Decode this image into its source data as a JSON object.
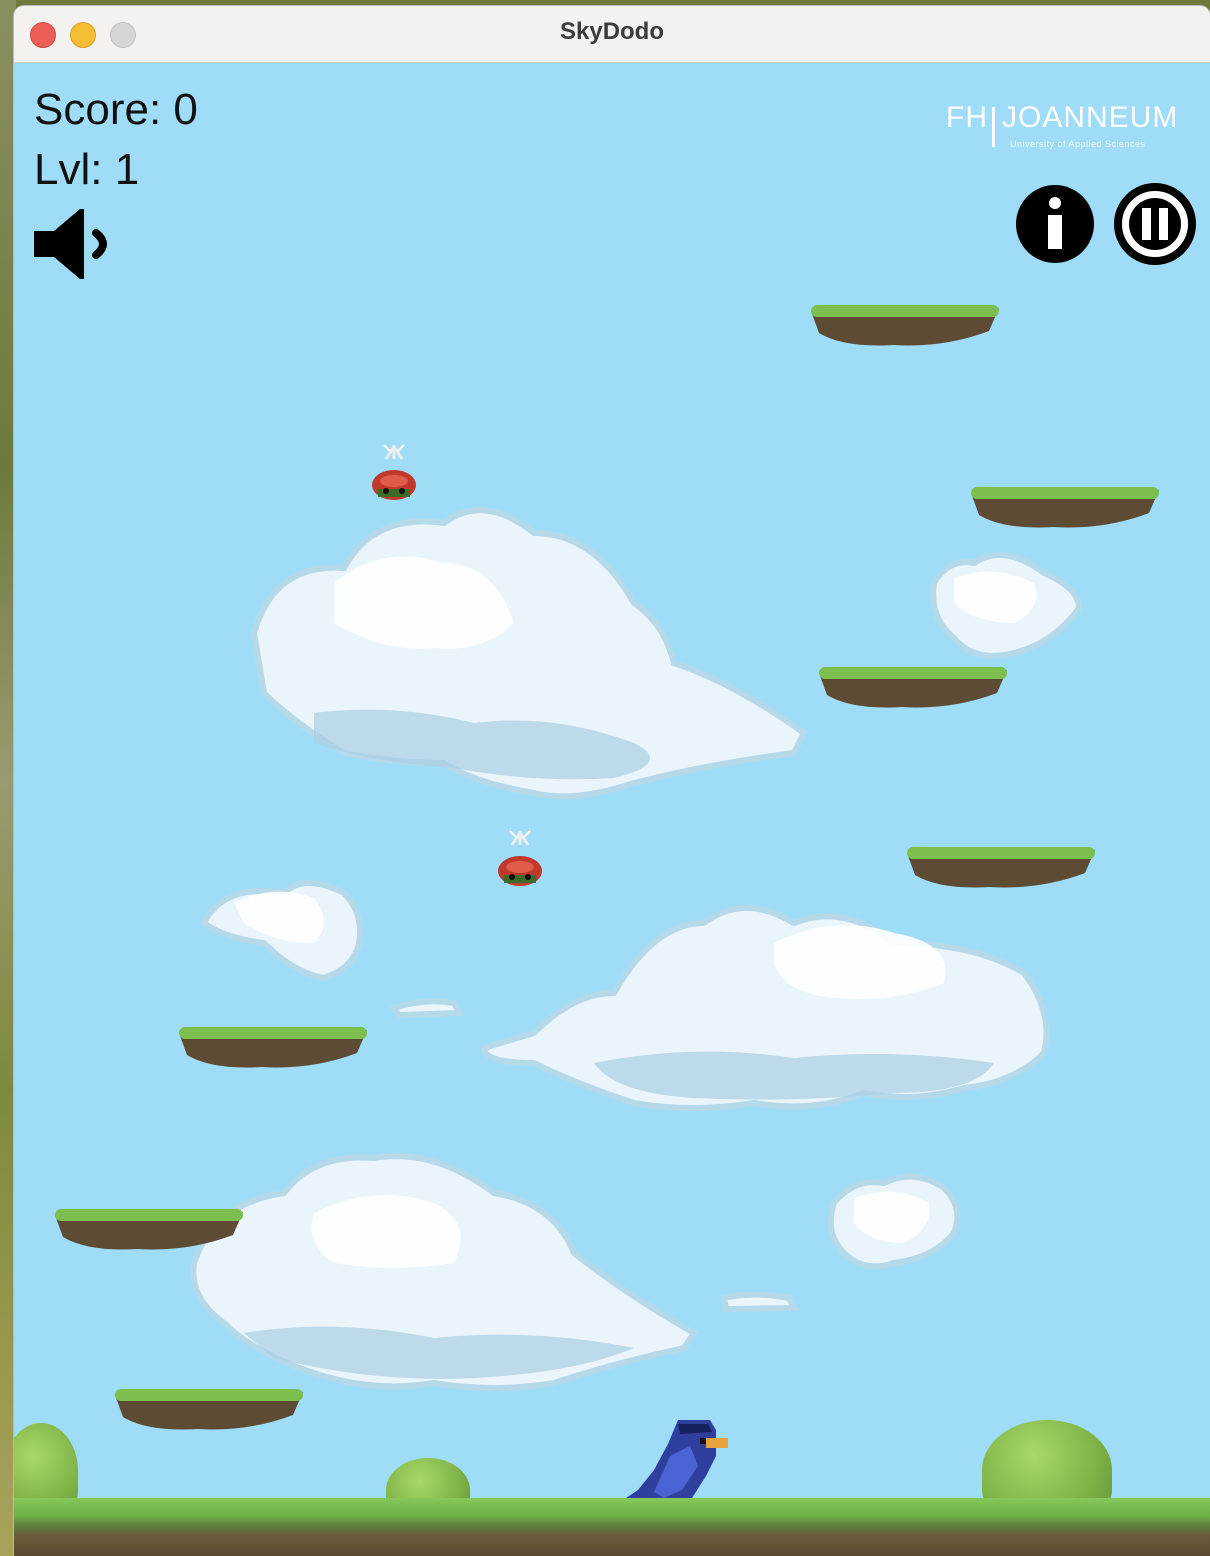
{
  "window": {
    "title": "SkyDodo"
  },
  "hud": {
    "score_label": "Score: 0",
    "level_label": "Lvl: 1"
  },
  "logo": {
    "brand": "FH",
    "name": "JOANNEUM",
    "tagline": "University of Applied Sciences"
  },
  "controls": {
    "sound": "speaker-icon",
    "info": "info-icon",
    "pause": "pause-icon"
  },
  "colors": {
    "sky": "#9fdcf8",
    "grass": "#7cbf4f",
    "dirt": "#5e4b33",
    "bird": "#2f3f9e",
    "beetle": "#c0392b"
  },
  "scene": {
    "platform_count": 7,
    "enemy_count": 2,
    "player": "bird"
  }
}
